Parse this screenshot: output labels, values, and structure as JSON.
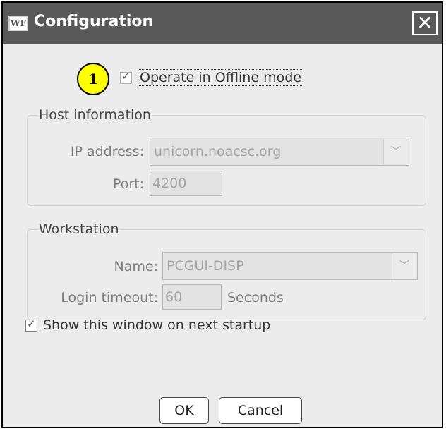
{
  "window": {
    "icon_text": "WF",
    "title": "Configuration",
    "close_glyph": "✕"
  },
  "callout": {
    "number": "1"
  },
  "offline": {
    "label": "Operate in Offline mode",
    "checked": true
  },
  "host": {
    "legend": "Host information",
    "ip_label": "IP address:",
    "ip_value": "unicorn.noacsc.org",
    "port_label": "Port:",
    "port_value": "4200"
  },
  "workstation": {
    "legend": "Workstation",
    "name_label": "Name:",
    "name_value": "PCGUI-DISP",
    "timeout_label": "Login timeout:",
    "timeout_value": "60",
    "timeout_unit": "Seconds"
  },
  "startup": {
    "label": "Show this window on next startup",
    "checked": true
  },
  "buttons": {
    "ok": "OK",
    "cancel": "Cancel"
  },
  "icons": {
    "check": "✓",
    "dropdown": "﹀"
  }
}
